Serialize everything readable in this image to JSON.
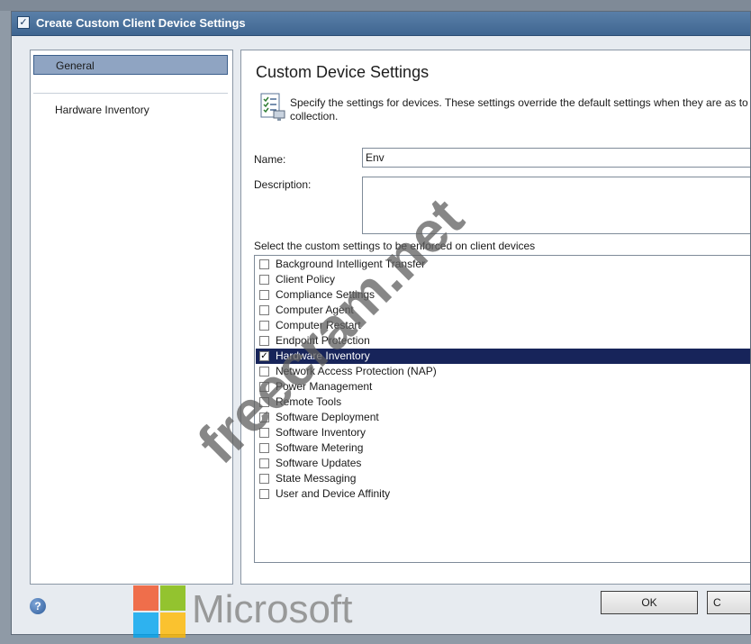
{
  "window": {
    "title": "Create Custom Client Device Settings"
  },
  "nav": {
    "items": [
      {
        "label": "General",
        "selected": true
      },
      {
        "label": "Hardware Inventory",
        "selected": false
      }
    ]
  },
  "content": {
    "heading": "Custom Device Settings",
    "description": "Specify the settings for devices. These settings override the default settings when they are as to a collection.",
    "name_label": "Name:",
    "name_value": "Env",
    "description_label": "Description:",
    "description_value": "",
    "list_label": "Select the custom settings to be enforced on client devices",
    "settings": [
      {
        "label": "Background Intelligent Transfer",
        "checked": false,
        "selected": false
      },
      {
        "label": "Client Policy",
        "checked": false,
        "selected": false
      },
      {
        "label": "Compliance Settings",
        "checked": false,
        "selected": false
      },
      {
        "label": "Computer Agent",
        "checked": false,
        "selected": false
      },
      {
        "label": "Computer Restart",
        "checked": false,
        "selected": false
      },
      {
        "label": "Endpoint Protection",
        "checked": false,
        "selected": false
      },
      {
        "label": "Hardware Inventory",
        "checked": true,
        "selected": true
      },
      {
        "label": "Network Access Protection (NAP)",
        "checked": false,
        "selected": false
      },
      {
        "label": "Power Management",
        "checked": false,
        "selected": false
      },
      {
        "label": "Remote Tools",
        "checked": false,
        "selected": false
      },
      {
        "label": "Software Deployment",
        "checked": false,
        "selected": false
      },
      {
        "label": "Software Inventory",
        "checked": false,
        "selected": false
      },
      {
        "label": "Software Metering",
        "checked": false,
        "selected": false
      },
      {
        "label": "Software Updates",
        "checked": false,
        "selected": false
      },
      {
        "label": "State Messaging",
        "checked": false,
        "selected": false
      },
      {
        "label": "User and Device Affinity",
        "checked": false,
        "selected": false
      }
    ]
  },
  "footer": {
    "help_icon": "help-icon",
    "ok_label": "OK",
    "cancel_label": "C"
  },
  "overlay": {
    "brand_text": "Microsoft",
    "watermark_text": "freecram.net",
    "logo_colors": [
      "#f25022",
      "#7fba00",
      "#00a4ef",
      "#ffb900"
    ]
  },
  "colors": {
    "selected_row": "#17245a",
    "nav_selected": "#8fa4c2"
  }
}
